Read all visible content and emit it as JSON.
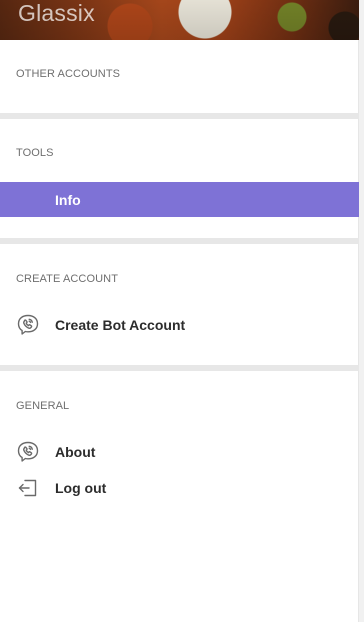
{
  "header": {
    "brand": "Glassix"
  },
  "sections": {
    "other_accounts": {
      "title": "OTHER ACCOUNTS"
    },
    "tools": {
      "title": "TOOLS",
      "items": [
        {
          "label": "Info",
          "active": true
        }
      ]
    },
    "create_account": {
      "title": "CREATE ACCOUNT",
      "items": [
        {
          "label": "Create Bot Account",
          "icon": "viber-phone-icon"
        }
      ]
    },
    "general": {
      "title": "GENERAL",
      "items": [
        {
          "label": "About",
          "icon": "viber-phone-icon"
        },
        {
          "label": "Log out",
          "icon": "logout-icon"
        }
      ]
    }
  },
  "colors": {
    "active_item_bg": "#7e72d6",
    "divider": "#e7e7e7",
    "section_title": "#6f6f6f",
    "item_label": "#2c2c2c"
  }
}
